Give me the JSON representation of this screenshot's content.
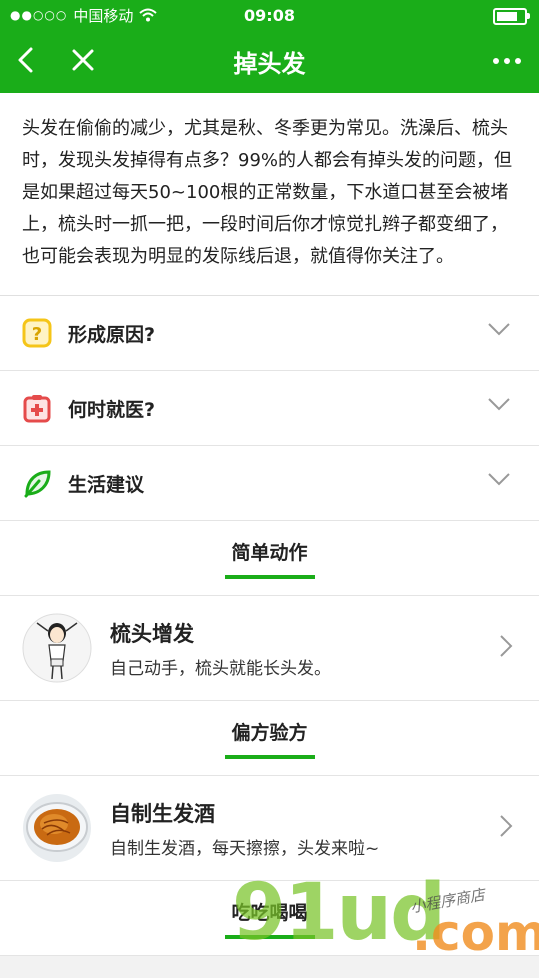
{
  "status": {
    "carrier": "中国移动",
    "signal": "●●○○○",
    "time": "09:08"
  },
  "nav": {
    "title": "掉头发",
    "back_icon": "chevron-left-icon",
    "close_icon": "close-icon",
    "more_icon": "more-icon"
  },
  "intro": "头发在偷偷的减少，尤其是秋、冬季更为常见。洗澡后、梳头时，发现头发掉得有点多？99%的人都会有掉头发的问题，但是如果超过每天50~100根的正常数量，下水道口甚至会被堵上，梳头时一抓一把，一段时间后你才惊觉扎辫子都变细了，也可能会表现为明显的发际线后退，就值得你关注了。",
  "accordion": [
    {
      "label": "形成原因?",
      "icon": "question-icon",
      "color": "#f5c518"
    },
    {
      "label": "何时就医?",
      "icon": "medical-kit-icon",
      "color": "#e54b4b"
    },
    {
      "label": "生活建议",
      "icon": "leaf-icon",
      "color": "#1aad19"
    }
  ],
  "sections": {
    "actions": {
      "title": "简单动作",
      "card": {
        "title": "梳头增发",
        "desc": "自己动手，梳头就能长头发。"
      }
    },
    "remedies": {
      "title": "偏方验方",
      "card": {
        "title": "自制生发酒",
        "desc": "自制生发酒，每天擦擦，头发来啦~"
      }
    },
    "food": {
      "title": "吃吃喝喝"
    }
  },
  "watermark": {
    "big": "91ud",
    "dotcom": ".com",
    "small": "小程序商店"
  },
  "colors": {
    "accent": "#1aad19"
  }
}
